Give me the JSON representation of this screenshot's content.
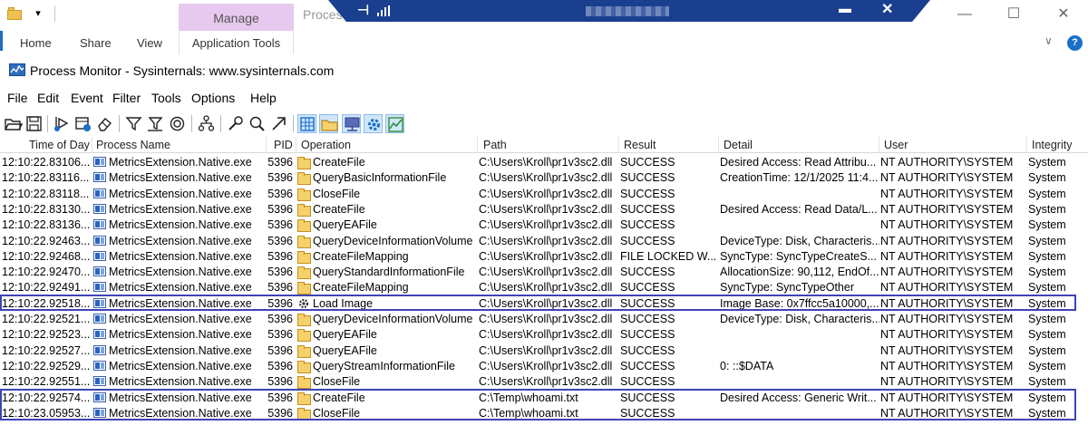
{
  "explorer": {
    "manage_tab": "Manage",
    "title_fragment": "Proces",
    "tabs": [
      "Home",
      "Share",
      "View",
      "Application Tools"
    ]
  },
  "rdp_bar": {
    "pin": "⊣",
    "minimize": "▬",
    "close": "✕"
  },
  "window_controls": {
    "minimize": "—",
    "maximize": "☐",
    "close": "✕"
  },
  "procmon": {
    "title": "Process Monitor - Sysinternals: www.sysinternals.com",
    "menu": [
      "File",
      "Edit",
      "Event",
      "Filter",
      "Tools",
      "Options",
      "Help"
    ],
    "columns": [
      "Time of Day",
      "Process Name",
      "PID",
      "Operation",
      "Path",
      "Result",
      "Detail",
      "User",
      "Integrity"
    ],
    "rows": [
      {
        "time": "12:10:22.83106...",
        "process": "MetricsExtension.Native.exe",
        "pid": "5396",
        "op": "CreateFile",
        "path": "C:\\Users\\Kroll\\pr1v3sc2.dll",
        "result": "SUCCESS",
        "detail": "Desired Access: Read Attribu...",
        "user": "NT AUTHORITY\\SYSTEM",
        "integrity": "System"
      },
      {
        "time": "12:10:22.83116...",
        "process": "MetricsExtension.Native.exe",
        "pid": "5396",
        "op": "QueryBasicInformationFile",
        "path": "C:\\Users\\Kroll\\pr1v3sc2.dll",
        "result": "SUCCESS",
        "detail": "CreationTime: 12/1/2025 11:4...",
        "user": "NT AUTHORITY\\SYSTEM",
        "integrity": "System"
      },
      {
        "time": "12:10:22.83118...",
        "process": "MetricsExtension.Native.exe",
        "pid": "5396",
        "op": "CloseFile",
        "path": "C:\\Users\\Kroll\\pr1v3sc2.dll",
        "result": "SUCCESS",
        "detail": "",
        "user": "NT AUTHORITY\\SYSTEM",
        "integrity": "System"
      },
      {
        "time": "12:10:22.83130...",
        "process": "MetricsExtension.Native.exe",
        "pid": "5396",
        "op": "CreateFile",
        "path": "C:\\Users\\Kroll\\pr1v3sc2.dll",
        "result": "SUCCESS",
        "detail": "Desired Access: Read Data/L...",
        "user": "NT AUTHORITY\\SYSTEM",
        "integrity": "System"
      },
      {
        "time": "12:10:22.83136...",
        "process": "MetricsExtension.Native.exe",
        "pid": "5396",
        "op": "QueryEAFile",
        "path": "C:\\Users\\Kroll\\pr1v3sc2.dll",
        "result": "SUCCESS",
        "detail": "",
        "user": "NT AUTHORITY\\SYSTEM",
        "integrity": "System"
      },
      {
        "time": "12:10:22.92463...",
        "process": "MetricsExtension.Native.exe",
        "pid": "5396",
        "op": "QueryDeviceInformationVolume",
        "path": "C:\\Users\\Kroll\\pr1v3sc2.dll",
        "result": "SUCCESS",
        "detail": "DeviceType: Disk, Characteris...",
        "user": "NT AUTHORITY\\SYSTEM",
        "integrity": "System"
      },
      {
        "time": "12:10:22.92468...",
        "process": "MetricsExtension.Native.exe",
        "pid": "5396",
        "op": "CreateFileMapping",
        "path": "C:\\Users\\Kroll\\pr1v3sc2.dll",
        "result": "FILE LOCKED W...",
        "detail": "SyncType: SyncTypeCreateS...",
        "user": "NT AUTHORITY\\SYSTEM",
        "integrity": "System"
      },
      {
        "time": "12:10:22.92470...",
        "process": "MetricsExtension.Native.exe",
        "pid": "5396",
        "op": "QueryStandardInformationFile",
        "path": "C:\\Users\\Kroll\\pr1v3sc2.dll",
        "result": "SUCCESS",
        "detail": "AllocationSize: 90,112, EndOf...",
        "user": "NT AUTHORITY\\SYSTEM",
        "integrity": "System"
      },
      {
        "time": "12:10:22.92491...",
        "process": "MetricsExtension.Native.exe",
        "pid": "5396",
        "op": "CreateFileMapping",
        "path": "C:\\Users\\Kroll\\pr1v3sc2.dll",
        "result": "SUCCESS",
        "detail": "SyncType: SyncTypeOther",
        "user": "NT AUTHORITY\\SYSTEM",
        "integrity": "System"
      },
      {
        "time": "12:10:22.92518...",
        "process": "MetricsExtension.Native.exe",
        "pid": "5396",
        "op": "Load Image",
        "path": "C:\\Users\\Kroll\\pr1v3sc2.dll",
        "result": "SUCCESS",
        "detail": "Image Base: 0x7ffcc5a10000,...",
        "user": "NT AUTHORITY\\SYSTEM",
        "integrity": "System",
        "icon": "gear"
      },
      {
        "time": "12:10:22.92521...",
        "process": "MetricsExtension.Native.exe",
        "pid": "5396",
        "op": "QueryDeviceInformationVolume",
        "path": "C:\\Users\\Kroll\\pr1v3sc2.dll",
        "result": "SUCCESS",
        "detail": "DeviceType: Disk, Characteris...",
        "user": "NT AUTHORITY\\SYSTEM",
        "integrity": "System"
      },
      {
        "time": "12:10:22.92523...",
        "process": "MetricsExtension.Native.exe",
        "pid": "5396",
        "op": "QueryEAFile",
        "path": "C:\\Users\\Kroll\\pr1v3sc2.dll",
        "result": "SUCCESS",
        "detail": "",
        "user": "NT AUTHORITY\\SYSTEM",
        "integrity": "System"
      },
      {
        "time": "12:10:22.92527...",
        "process": "MetricsExtension.Native.exe",
        "pid": "5396",
        "op": "QueryEAFile",
        "path": "C:\\Users\\Kroll\\pr1v3sc2.dll",
        "result": "SUCCESS",
        "detail": "",
        "user": "NT AUTHORITY\\SYSTEM",
        "integrity": "System"
      },
      {
        "time": "12:10:22.92529...",
        "process": "MetricsExtension.Native.exe",
        "pid": "5396",
        "op": "QueryStreamInformationFile",
        "path": "C:\\Users\\Kroll\\pr1v3sc2.dll",
        "result": "SUCCESS",
        "detail": "0: ::$DATA",
        "user": "NT AUTHORITY\\SYSTEM",
        "integrity": "System"
      },
      {
        "time": "12:10:22.92551...",
        "process": "MetricsExtension.Native.exe",
        "pid": "5396",
        "op": "CloseFile",
        "path": "C:\\Users\\Kroll\\pr1v3sc2.dll",
        "result": "SUCCESS",
        "detail": "",
        "user": "NT AUTHORITY\\SYSTEM",
        "integrity": "System"
      },
      {
        "time": "12:10:22.92574...",
        "process": "MetricsExtension.Native.exe",
        "pid": "5396",
        "op": "CreateFile",
        "path": "C:\\Temp\\whoami.txt",
        "result": "SUCCESS",
        "detail": "Desired Access: Generic Writ...",
        "user": "NT AUTHORITY\\SYSTEM",
        "integrity": "System"
      },
      {
        "time": "12:10:23.05953...",
        "process": "MetricsExtension.Native.exe",
        "pid": "5396",
        "op": "CloseFile",
        "path": "C:\\Temp\\whoami.txt",
        "result": "SUCCESS",
        "detail": "",
        "user": "NT AUTHORITY\\SYSTEM",
        "integrity": "System"
      }
    ],
    "highlighted_rows": [
      [
        9,
        9
      ],
      [
        15,
        16
      ]
    ]
  },
  "colors": {
    "highlight": "#3e44b5",
    "manage_tab": "#e7c8ee",
    "rdp_bar": "#1a3f8f",
    "accent": "#1a6fc9"
  }
}
